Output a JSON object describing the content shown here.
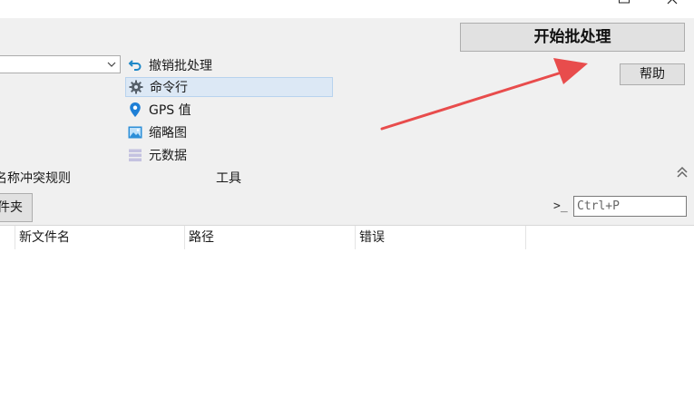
{
  "window": {
    "minimize_icon": "minimize-icon",
    "maximize_icon": "maximize-icon",
    "close_icon": "close-icon"
  },
  "actions": {
    "start_batch": "开始批处理",
    "help": "帮助"
  },
  "tools_list": {
    "items": [
      {
        "label": "撤销批处理",
        "icon": "undo-icon"
      },
      {
        "label": "命令行",
        "icon": "gear-icon",
        "selected": true
      },
      {
        "label": "GPS 值",
        "icon": "location-pin-icon"
      },
      {
        "label": "缩略图",
        "icon": "image-icon"
      },
      {
        "label": "元数据",
        "icon": "database-icon"
      }
    ]
  },
  "section": {
    "conflict_rule_label": "名称冲突规则",
    "tools_label": "工具",
    "folder_button": "件夹"
  },
  "command": {
    "prompt_symbol": ">_",
    "shortcut_placeholder": "Ctrl+P"
  },
  "table": {
    "columns": [
      "新文件名",
      "路径",
      "错误"
    ]
  },
  "colors": {
    "panel_bg": "#f0f0f0",
    "button_bg": "#e1e1e1",
    "selection_bg": "#dce8f5",
    "annotation_arrow": "#e84c4c"
  }
}
